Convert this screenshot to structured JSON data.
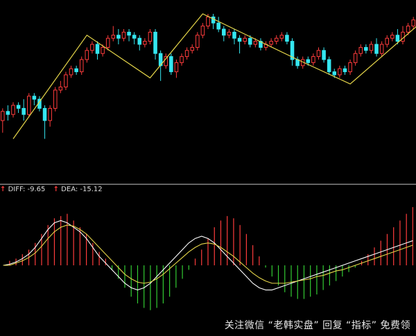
{
  "legend": {
    "diff_label": "DIFF",
    "diff_value": "-9.65",
    "dea_label": "DEA",
    "dea_value": "-15.12",
    "up_arrow": "↑"
  },
  "watermark": "关注微信 “老韩实盘” 回复 “指标” 免费领",
  "colors": {
    "up": "#ff3c3c",
    "down": "#35e6f0",
    "trend": "#e6d64a",
    "diff": "#ffffff",
    "dea": "#e6d64a",
    "hist_pos": "#ff3c3c",
    "hist_neg": "#33cc33",
    "divider": "#c8c8c8"
  },
  "chart_data": [
    {
      "type": "candlestick",
      "ylim": [
        0,
        100
      ],
      "candles": [
        [
          30,
          36,
          22,
          38
        ],
        [
          36,
          34,
          30,
          40
        ],
        [
          34,
          40,
          32,
          42
        ],
        [
          40,
          38,
          35,
          42
        ],
        [
          38,
          34,
          30,
          44
        ],
        [
          34,
          46,
          32,
          48
        ],
        [
          46,
          44,
          40,
          48
        ],
        [
          44,
          38,
          36,
          46
        ],
        [
          38,
          30,
          18,
          40
        ],
        [
          30,
          38,
          26,
          40
        ],
        [
          38,
          50,
          36,
          52
        ],
        [
          50,
          52,
          48,
          56
        ],
        [
          52,
          60,
          50,
          62
        ],
        [
          60,
          64,
          58,
          66
        ],
        [
          64,
          62,
          60,
          66
        ],
        [
          62,
          70,
          60,
          72
        ],
        [
          70,
          76,
          68,
          78
        ],
        [
          76,
          80,
          74,
          82
        ],
        [
          80,
          74,
          70,
          82
        ],
        [
          74,
          78,
          72,
          80
        ],
        [
          78,
          84,
          76,
          86
        ],
        [
          84,
          86,
          82,
          92
        ],
        [
          86,
          84,
          80,
          90
        ],
        [
          84,
          88,
          82,
          90
        ],
        [
          88,
          86,
          82,
          90
        ],
        [
          86,
          84,
          80,
          88
        ],
        [
          84,
          80,
          76,
          86
        ],
        [
          80,
          82,
          78,
          84
        ],
        [
          82,
          88,
          80,
          90
        ],
        [
          88,
          74,
          70,
          90
        ],
        [
          74,
          66,
          56,
          76
        ],
        [
          66,
          72,
          64,
          74
        ],
        [
          72,
          62,
          60,
          74
        ],
        [
          62,
          68,
          58,
          70
        ],
        [
          68,
          72,
          66,
          74
        ],
        [
          72,
          76,
          70,
          78
        ],
        [
          76,
          78,
          74,
          80
        ],
        [
          78,
          86,
          76,
          88
        ],
        [
          86,
          92,
          84,
          94
        ],
        [
          92,
          98,
          90,
          100
        ],
        [
          98,
          94,
          90,
          100
        ],
        [
          94,
          90,
          88,
          98
        ],
        [
          90,
          86,
          82,
          92
        ],
        [
          86,
          88,
          84,
          90
        ],
        [
          88,
          84,
          80,
          90
        ],
        [
          84,
          82,
          74,
          86
        ],
        [
          82,
          84,
          80,
          86
        ],
        [
          84,
          80,
          78,
          86
        ],
        [
          80,
          82,
          78,
          84
        ],
        [
          82,
          78,
          76,
          84
        ],
        [
          78,
          80,
          76,
          82
        ],
        [
          80,
          82,
          78,
          84
        ],
        [
          82,
          84,
          80,
          86
        ],
        [
          84,
          86,
          82,
          88
        ],
        [
          86,
          82,
          80,
          88
        ],
        [
          82,
          70,
          66,
          84
        ],
        [
          70,
          66,
          64,
          72
        ],
        [
          66,
          70,
          64,
          72
        ],
        [
          70,
          68,
          66,
          72
        ],
        [
          68,
          72,
          66,
          74
        ],
        [
          72,
          76,
          70,
          78
        ],
        [
          76,
          70,
          68,
          78
        ],
        [
          70,
          62,
          60,
          72
        ],
        [
          62,
          60,
          58,
          64
        ],
        [
          60,
          64,
          58,
          66
        ],
        [
          64,
          62,
          60,
          66
        ],
        [
          62,
          68,
          60,
          70
        ],
        [
          68,
          74,
          66,
          76
        ],
        [
          74,
          78,
          72,
          80
        ],
        [
          78,
          76,
          74,
          80
        ],
        [
          76,
          80,
          74,
          82
        ],
        [
          80,
          74,
          72,
          84
        ],
        [
          74,
          80,
          72,
          82
        ],
        [
          80,
          84,
          78,
          86
        ],
        [
          84,
          86,
          82,
          88
        ],
        [
          86,
          82,
          80,
          90
        ],
        [
          82,
          88,
          80,
          92
        ],
        [
          88,
          92,
          86,
          94
        ],
        [
          92,
          96,
          90,
          98
        ]
      ],
      "trend_points": [
        [
          2,
          18
        ],
        [
          16,
          86
        ],
        [
          28,
          58
        ],
        [
          38,
          100
        ],
        [
          56,
          70
        ],
        [
          66,
          54
        ],
        [
          80,
          96
        ]
      ]
    },
    {
      "type": "bar",
      "ylim": [
        -60,
        60
      ],
      "series": [
        {
          "values": [
            0,
            4,
            6,
            10,
            14,
            20,
            28,
            36,
            42,
            44,
            46,
            40,
            34,
            28,
            20,
            12,
            6,
            -4,
            -12,
            -20,
            -28,
            -34,
            -38,
            -40,
            -38,
            -34,
            -28,
            -20,
            -12,
            -4,
            6,
            14,
            24,
            34,
            40,
            44,
            42,
            36,
            28,
            18,
            8,
            -2,
            -10,
            -18,
            -24,
            -28,
            -30,
            -30,
            -28,
            -26,
            -22,
            -18,
            -14,
            -10,
            -6,
            -2,
            4,
            10,
            16,
            22,
            28,
            34,
            40,
            46,
            52
          ]
        }
      ],
      "lines": [
        {
          "values": [
            0,
            1,
            3,
            6,
            10,
            16,
            24,
            32,
            38,
            40,
            38,
            34,
            30,
            24,
            16,
            8,
            2,
            -4,
            -10,
            -16,
            -20,
            -22,
            -20,
            -16,
            -10,
            -4,
            2,
            8,
            14,
            20,
            24,
            26,
            24,
            20,
            14,
            8,
            2,
            -4,
            -10,
            -16,
            -20,
            -22,
            -22,
            -20,
            -18,
            -16,
            -14,
            -12,
            -10,
            -8,
            -6,
            -4,
            -2,
            0,
            2,
            4,
            6,
            8,
            10,
            12,
            14,
            16,
            18,
            20,
            22
          ]
        },
        {
          "values": [
            0,
            0,
            2,
            4,
            7,
            11,
            17,
            24,
            30,
            34,
            36,
            35,
            32,
            28,
            22,
            16,
            10,
            4,
            -2,
            -8,
            -12,
            -15,
            -16,
            -15,
            -12,
            -8,
            -3,
            2,
            7,
            12,
            16,
            19,
            20,
            19,
            16,
            12,
            8,
            3,
            -2,
            -7,
            -11,
            -14,
            -16,
            -16,
            -16,
            -15,
            -14,
            -13,
            -12,
            -10,
            -9,
            -7,
            -5,
            -4,
            -2,
            0,
            2,
            4,
            6,
            8,
            10,
            12,
            14,
            16,
            18
          ]
        }
      ]
    }
  ]
}
